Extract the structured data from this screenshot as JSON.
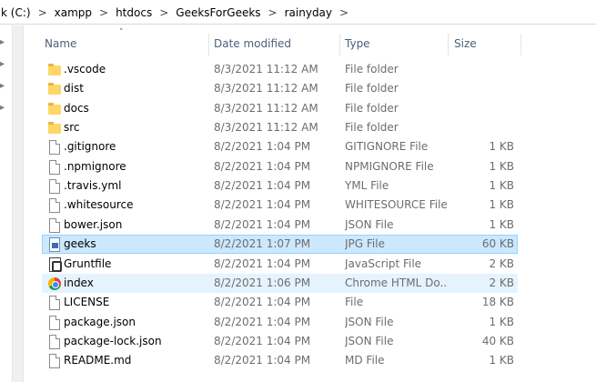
{
  "address_bar": {
    "crumbs": [
      "k (C:)",
      "xampp",
      "htdocs",
      "GeeksForGeeks",
      "rainyday"
    ],
    "separator": ">"
  },
  "columns": {
    "name": "Name",
    "date": "Date modified",
    "type": "Type",
    "size": "Size"
  },
  "files": [
    {
      "name": ".vscode",
      "date": "8/3/2021 11:12 AM",
      "type": "File folder",
      "size": "",
      "icon": "folder-icon"
    },
    {
      "name": "dist",
      "date": "8/3/2021 11:12 AM",
      "type": "File folder",
      "size": "",
      "icon": "folder-icon"
    },
    {
      "name": "docs",
      "date": "8/3/2021 11:12 AM",
      "type": "File folder",
      "size": "",
      "icon": "folder-icon"
    },
    {
      "name": "src",
      "date": "8/3/2021 11:12 AM",
      "type": "File folder",
      "size": "",
      "icon": "folder-icon"
    },
    {
      "name": ".gitignore",
      "date": "8/2/2021 1:04 PM",
      "type": "GITIGNORE File",
      "size": "1 KB",
      "icon": "file-icon"
    },
    {
      "name": ".npmignore",
      "date": "8/2/2021 1:04 PM",
      "type": "NPMIGNORE File",
      "size": "1 KB",
      "icon": "file-icon"
    },
    {
      "name": ".travis.yml",
      "date": "8/2/2021 1:04 PM",
      "type": "YML File",
      "size": "1 KB",
      "icon": "file-icon"
    },
    {
      "name": ".whitesource",
      "date": "8/2/2021 1:04 PM",
      "type": "WHITESOURCE File",
      "size": "1 KB",
      "icon": "file-icon"
    },
    {
      "name": "bower.json",
      "date": "8/2/2021 1:04 PM",
      "type": "JSON File",
      "size": "1 KB",
      "icon": "file-icon"
    },
    {
      "name": "geeks",
      "date": "8/2/2021 1:07 PM",
      "type": "JPG File",
      "size": "60 KB",
      "icon": "image-file-icon",
      "state": "selected"
    },
    {
      "name": "Gruntfile",
      "date": "8/2/2021 1:04 PM",
      "type": "JavaScript File",
      "size": "2 KB",
      "icon": "javascript-file-icon"
    },
    {
      "name": "index",
      "date": "8/2/2021 1:06 PM",
      "type": "Chrome HTML Do...",
      "size": "2 KB",
      "icon": "chrome-icon",
      "state": "hover"
    },
    {
      "name": "LICENSE",
      "date": "8/2/2021 1:04 PM",
      "type": "File",
      "size": "18 KB",
      "icon": "file-icon"
    },
    {
      "name": "package.json",
      "date": "8/2/2021 1:04 PM",
      "type": "JSON File",
      "size": "1 KB",
      "icon": "file-icon"
    },
    {
      "name": "package-lock.json",
      "date": "8/2/2021 1:04 PM",
      "type": "JSON File",
      "size": "40 KB",
      "icon": "file-icon"
    },
    {
      "name": "README.md",
      "date": "8/2/2021 1:04 PM",
      "type": "MD File",
      "size": "1 KB",
      "icon": "file-icon"
    }
  ],
  "colors": {
    "selected_bg": "#cce8ff",
    "hover_bg": "#e5f3ff",
    "header_text": "#4c607a",
    "meta_text": "#6d6d6d"
  }
}
